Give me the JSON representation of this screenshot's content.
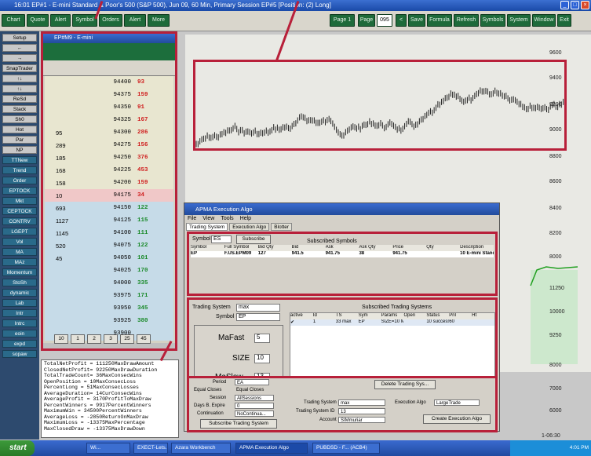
{
  "window": {
    "title": "16:01 EP#1 - E-mini Standard & Poor's 500 (S&P 500), Jun 09, 60 Min, Primary Session EP#5 [Position: (2) Long]"
  },
  "toolbar": {
    "left_buttons": [
      "Chart",
      "Quote",
      "Alert",
      "Symbol",
      "Orders",
      "Alert",
      "More"
    ],
    "right_buttons": [
      "Page 1",
      "Page",
      "095",
      "<",
      "Save",
      "Formula",
      "Refresh",
      "Symbols",
      "System",
      "Window",
      "Exit"
    ]
  },
  "sidebar": {
    "items": [
      "Setup",
      "←",
      "→",
      "SnapTrader",
      "↑↓",
      "↑↓",
      "ReSd",
      "Stack",
      "Sh0",
      "Hot",
      "Par",
      "NP",
      "TTNew",
      "Trend",
      "Order",
      "EPTOCK",
      "Mkt",
      "CEPTOCK",
      "CONTRV",
      "LGEPT",
      "Vol",
      "MA",
      "MAz",
      "Momentum",
      "StoSh",
      "dynamic",
      "Lab",
      "Intr",
      "Intrc",
      "eoin",
      "expd",
      "sopaw"
    ]
  },
  "ladder": {
    "title": "EP#M9 - E-mini",
    "rows": [
      {
        "bid": "",
        "price": "94400",
        "vol": "93",
        "type": "ask"
      },
      {
        "bid": "",
        "price": "94375",
        "vol": "159",
        "type": "ask"
      },
      {
        "bid": "",
        "price": "94350",
        "vol": "91",
        "type": "ask"
      },
      {
        "bid": "",
        "price": "94325",
        "vol": "167",
        "type": "ask"
      },
      {
        "bid": "95",
        "price": "94300",
        "vol": "286",
        "type": "ask"
      },
      {
        "bid": "289",
        "price": "94275",
        "vol": "156",
        "type": "ask"
      },
      {
        "bid": "185",
        "price": "94250",
        "vol": "376",
        "type": "ask"
      },
      {
        "bid": "168",
        "price": "94225",
        "vol": "453",
        "type": "ask"
      },
      {
        "bid": "158",
        "price": "94200",
        "vol": "159",
        "type": "ask"
      },
      {
        "bid": "10",
        "price": "94175",
        "vol": "34",
        "type": "last"
      },
      {
        "bid": "693",
        "price": "94150",
        "vol": "122",
        "type": "bid"
      },
      {
        "bid": "1127",
        "price": "94125",
        "vol": "115",
        "type": "bid"
      },
      {
        "bid": "1145",
        "price": "94100",
        "vol": "111",
        "type": "bid"
      },
      {
        "bid": "520",
        "price": "94075",
        "vol": "122",
        "type": "bid"
      },
      {
        "bid": "45",
        "price": "94050",
        "vol": "101",
        "type": "bid"
      },
      {
        "bid": "",
        "price": "94025",
        "vol": "170",
        "type": "bid"
      },
      {
        "bid": "",
        "price": "94000",
        "vol": "335",
        "type": "bid"
      },
      {
        "bid": "",
        "price": "93975",
        "vol": "171",
        "type": "bid"
      },
      {
        "bid": "",
        "price": "93950",
        "vol": "345",
        "type": "bid"
      },
      {
        "bid": "",
        "price": "93925",
        "vol": "380",
        "type": "bid"
      },
      {
        "bid": "",
        "price": "93900",
        "vol": "",
        "type": "bid"
      }
    ],
    "qty_buttons": [
      "10",
      "1",
      "2",
      "3",
      "25",
      "45"
    ]
  },
  "yaxis": [
    "9600",
    "9400",
    "9200",
    "9000",
    "8800",
    "8600",
    "8400",
    "8200",
    "8000",
    "11250",
    "10000",
    "9250",
    "8000",
    "7000",
    "6000",
    "1-06:30"
  ],
  "algo": {
    "title": "APMA Execution Algo",
    "menu": [
      "File",
      "View",
      "Tools",
      "Help"
    ],
    "tabs": [
      "Trading System",
      "Execution Algo",
      "Blotter"
    ],
    "symbol_label": "Symbol",
    "symbol_value": "ES",
    "subscribe": "Subscribe",
    "subscribed_symbols_title": "Subscribed Symbols",
    "sym_headers": [
      "Symbol",
      "Full Symbol",
      "Bid Qty",
      "Bid",
      "Ask",
      "Ask Qty",
      "Price",
      "Qty",
      "Description"
    ],
    "sym_row": [
      "EP",
      "F.US.EPM09",
      "127",
      "941.5",
      "941.75",
      "38",
      "941.75",
      "",
      "10 E-mini Standard & Poor's"
    ],
    "ts_label": "Trading System",
    "ts_value": "max",
    "ts_symbol_label": "Symbol",
    "ts_symbol_value": "EP",
    "mafast_label": "MaFast",
    "mafast_value": "5",
    "size_label": "SIZE",
    "size_value": "10",
    "maslow_label": "MaSlow",
    "maslow_value": "13",
    "subscribed_ts_title": "Subscribed Trading Systems",
    "ts_headers": [
      "active",
      "Id",
      "TS",
      "Sym",
      "Params",
      "Open",
      "Status",
      "Pnl",
      "Ht"
    ],
    "ts_row": [
      "✔",
      "1",
      "33 max",
      "EP",
      "SIZE=10 Ma...",
      "",
      "10 success",
      "60",
      ""
    ],
    "period_label": "Period",
    "period_value": "EA",
    "equal_closes_label": "Equal Closes",
    "equal_closes_check": "Equal Closes",
    "session_label": "Session",
    "session_value": "AllSessions",
    "daysback_label": "Days B. Expire",
    "daysback_value": "0",
    "continuation_label": "Continuation",
    "continuation_value": "NoContinua...",
    "subscribe_ts": "Subscribe Trading System",
    "delete_ts": "Delete Trading Sys...",
    "exec_ts_label": "Trading System",
    "exec_ts_value": "max",
    "exec_id_label": "Trading System ID",
    "exec_id_value": "13",
    "account_label": "Account",
    "account_value": "SIMmuriar",
    "exec_algo_label": "Execution Algo",
    "exec_algo_value": "LargeTrade",
    "create_algo": "Create Execution Algo"
  },
  "stats": "TotalNetProfit = 111250MaxDrawAmount\nClosedNetProfit= 92250MaxDrawDuration\nTotalTradeCount= 36MaxConsecWins\nOpenPosition = 10MaxConsecLoss\nPercentLong = 51MaxConsecLosses\nAverageDuration= 14CurConsecWins\nAverageProfit = 3170ProfitToMaxDraw\nPercentWinners = 9917PercentWinners\nMaximumWin = 34500PercentWinners\nAverageLoss = -2850ReturnOnMaxDraw\nMaximumLoss = -13375MaxPercentage\nMaxClosedDraw = -13375MaxDrawDown",
  "taskbar": {
    "start": "start",
    "tasks": [
      "Wi...",
      "EXECT-Lets...",
      "Azara Workbench",
      "APMA Execution Algo",
      "PUBDSD - F... (ACB4)"
    ],
    "time": "4:01 PM"
  }
}
